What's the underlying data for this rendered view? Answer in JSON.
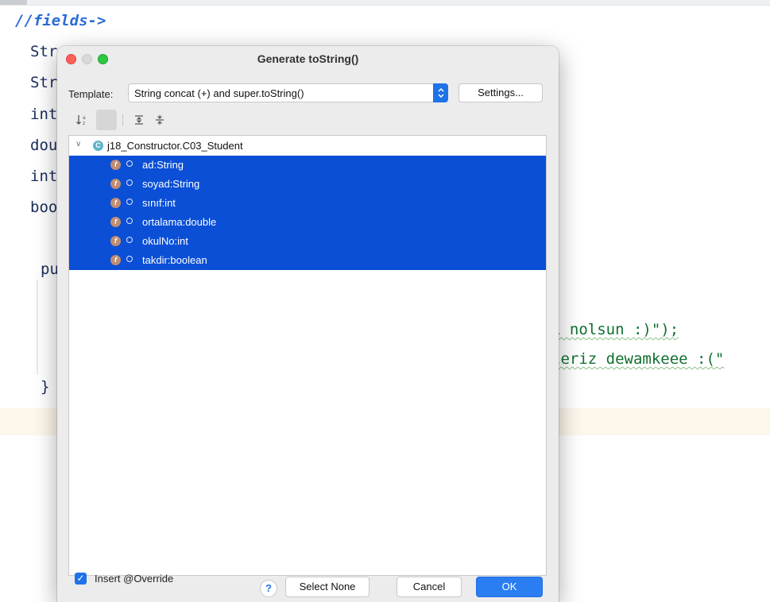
{
  "editor": {
    "comment_line": "//fields->",
    "lines": [
      "Str",
      "Str",
      "int",
      "dou",
      "int",
      "boo",
      "pu",
      "}"
    ],
    "right_line_1": "ı nolsun :)\");",
    "right_line_2": "leriz dewamkeee :(\""
  },
  "dialog": {
    "title": "Generate toString()",
    "template_label": "Template:",
    "template_value": "String concat (+) and super.toString()",
    "settings_label": "Settings...",
    "toolbar_icons": [
      "sort-alphabetically-icon",
      "show-classes-icon",
      "expand-all-icon",
      "collapse-all-icon"
    ],
    "tree": {
      "root": "j18_Constructor.C03_Student",
      "root_icon": "C",
      "field_icon": "f",
      "fields": [
        {
          "label": "ad:String"
        },
        {
          "label": "soyad:String"
        },
        {
          "label": "sınıf:int"
        },
        {
          "label": "ortalama:double"
        },
        {
          "label": "okulNo:int"
        },
        {
          "label": "takdir:boolean"
        }
      ]
    },
    "insert_override_label": "Insert @Override",
    "insert_override_checked": true,
    "help_label": "?",
    "select_none_label": "Select None",
    "cancel_label": "Cancel",
    "ok_label": "OK"
  },
  "colors": {
    "selection": "#0a4fd6",
    "accent": "#1e73e8",
    "close": "#fe5f57",
    "zoom": "#2bc840"
  }
}
